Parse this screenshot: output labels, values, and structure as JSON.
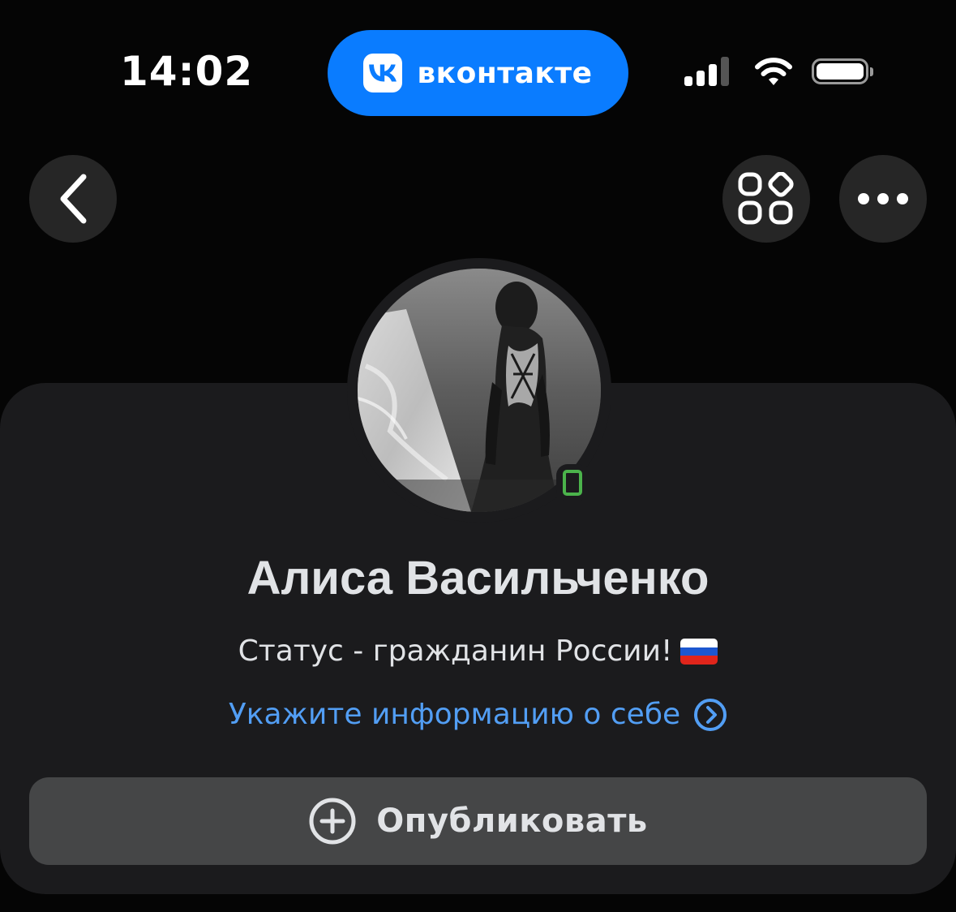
{
  "status_bar": {
    "time": "14:02",
    "app_pill_label": "вконтакте",
    "signal_icon": "cellular-signal-icon",
    "wifi_icon": "wifi-icon",
    "battery_icon": "battery-icon",
    "battery_level": 1.0
  },
  "nav": {
    "back_icon": "chevron-left-icon",
    "services_icon": "services-grid-icon",
    "more_icon": "more-dots-icon"
  },
  "profile": {
    "name": "Алиса Васильченко",
    "status": "Статус - гражданин России!",
    "status_emoji": "flag-russia-icon",
    "info_link": "Укажите информацию о себе",
    "online_indicator": "online-mobile-icon"
  },
  "actions": {
    "publish_label": "Опубликовать",
    "publish_icon": "plus-circle-icon"
  },
  "colors": {
    "accent_blue": "#0a7cff",
    "link_blue": "#529ef4",
    "online_green": "#4bb34b",
    "card_bg": "#1b1b1d",
    "button_bg": "#454647"
  }
}
